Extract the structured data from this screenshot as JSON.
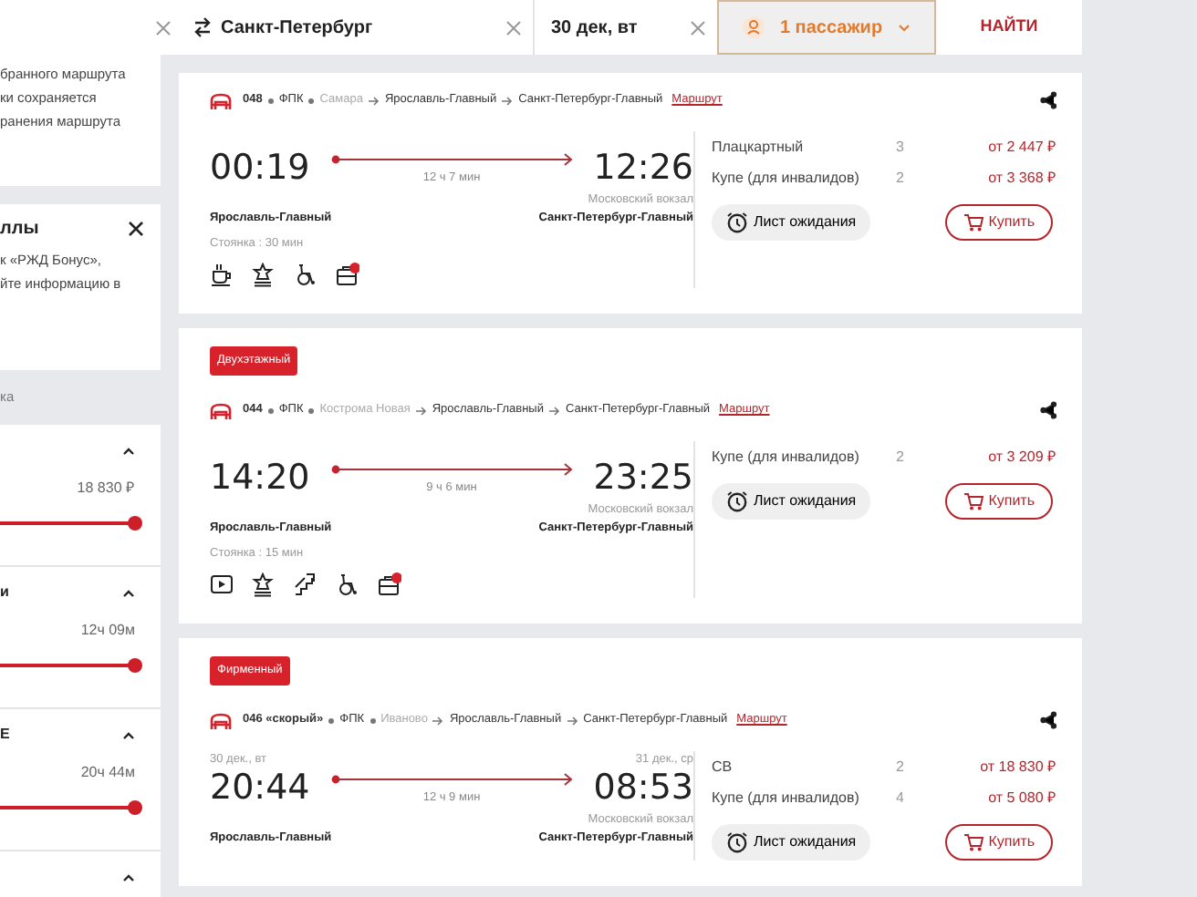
{
  "search": {
    "destination": "Санкт-Петербург",
    "date": "30 дек, вт",
    "passengers": "1 пассажир",
    "find_button": "НАЙТИ"
  },
  "sidebar": {
    "notice_lines": [
      "бранного маршрута",
      "ки сохраняется",
      "ранения маршрута"
    ],
    "bonus": {
      "title": "ллы",
      "lines": [
        "к «РЖД Бонус»,",
        "йте информацию в"
      ]
    },
    "section_label": "ка",
    "filters": [
      {
        "expanded": true,
        "value": "18 830 ₽",
        "level": 1
      },
      {
        "expanded": true,
        "title": "и",
        "value": "12ч 09м",
        "level": 1
      },
      {
        "expanded": true,
        "title": "Е",
        "value": "20ч 44м",
        "level": 1
      },
      {
        "expanded": true
      }
    ]
  },
  "trains": [
    {
      "number": "048",
      "carrier": "ФПК",
      "stops": [
        {
          "name": "Самара",
          "passed": true
        },
        {
          "name": "Ярославль-Главный",
          "passed": false
        },
        {
          "name": "Санкт-Петербург-Главный",
          "passed": false
        }
      ],
      "route_link": "Маршрут",
      "departure": "00:19",
      "duration": "12 ч 7 мин",
      "arrival": "12:26",
      "arrival_terminal": "Московский вокзал",
      "departure_station": "Ярославль-Главный",
      "arrival_station": "Санкт-Петербург-Главный",
      "stop": "Стоянка : 30 мин",
      "amenities": [
        {
          "kind": "dining"
        },
        {
          "kind": "award"
        },
        {
          "kind": "wheelchair"
        },
        {
          "kind": "luggage"
        }
      ],
      "classes": [
        {
          "name": "Плацкартный",
          "seats": "3",
          "price": "от 2 447 ₽"
        },
        {
          "name": "Купе (для инвалидов)",
          "seats": "2",
          "price": "от 3 368 ₽"
        }
      ],
      "waitlist": "Лист ожидания",
      "buy": "Купить"
    },
    {
      "badge": "Двухэтажный",
      "number": "044",
      "carrier": "ФПК",
      "stops": [
        {
          "name": "Кострома Новая",
          "passed": true
        },
        {
          "name": "Ярославль-Главный",
          "passed": false
        },
        {
          "name": "Санкт-Петербург-Главный",
          "passed": false
        }
      ],
      "route_link": "Маршрут",
      "departure": "14:20",
      "duration": "9 ч 6 мин",
      "arrival": "23:25",
      "arrival_terminal": "Московский вокзал",
      "departure_station": "Ярославль-Главный",
      "arrival_station": "Санкт-Петербург-Главный",
      "stop": "Стоянка : 15 мин",
      "amenities": [
        {
          "kind": "video"
        },
        {
          "kind": "award"
        },
        {
          "kind": "stairs"
        },
        {
          "kind": "wheelchair"
        },
        {
          "kind": "luggage"
        }
      ],
      "classes": [
        {
          "name": "Купе (для инвалидов)",
          "seats": "2",
          "price": "от 3 209 ₽"
        }
      ],
      "waitlist": "Лист ожидания",
      "buy": "Купить"
    },
    {
      "badge": "Фирменный",
      "number": "046 «скорый»",
      "carrier": "ФПК",
      "stops": [
        {
          "name": "Иваново",
          "passed": true
        },
        {
          "name": "Ярославль-Главный",
          "passed": false
        },
        {
          "name": "Санкт-Петербург-Главный",
          "passed": false
        }
      ],
      "route_link": "Маршрут",
      "departure_date": "30 дек., вт",
      "departure": "20:44",
      "duration": "12 ч 9 мин",
      "arrival_date": "31 дек., ср",
      "arrival": "08:53",
      "arrival_terminal": "Московский вокзал",
      "departure_station": "Ярославль-Главный",
      "arrival_station": "Санкт-Петербург-Главный",
      "classes": [
        {
          "name": "СВ",
          "seats": "2",
          "price": "от 18 830 ₽"
        },
        {
          "name": "Купе (для инвалидов)",
          "seats": "4",
          "price": "от 5 080 ₽"
        }
      ],
      "waitlist": "Лист ожидания",
      "buy": "Купить"
    }
  ]
}
